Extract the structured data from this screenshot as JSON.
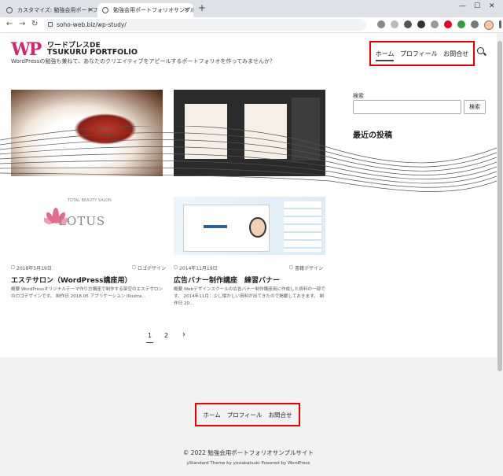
{
  "browser": {
    "tabs": [
      {
        "title": "カスタマイズ: 勉強会用ポートフォリオサ",
        "active": false
      },
      {
        "title": "勉強会用ポートフォリオサンプルサイト",
        "active": true
      }
    ],
    "new_tab": "+",
    "url": "soho-web.biz/wp-study/",
    "window_controls": {
      "minimize": "—",
      "maximize": "☐",
      "close": "✕"
    },
    "back": "←",
    "forward": "→",
    "reload": "↻"
  },
  "header": {
    "logo_mark": "WP",
    "logo_line1": "ワードプレスDE",
    "logo_line2": "TSUKURU PORTFOLIO",
    "tagline": "WordPressの勉強も兼ねて、あなたのクリエイティブをアピールするポートフォリオを作ってみませんか？",
    "nav": [
      {
        "label": "ホーム",
        "current": true
      },
      {
        "label": "プロフィール",
        "current": false
      },
      {
        "label": "お問合せ",
        "current": false
      }
    ],
    "highlight_color": "#e00000",
    "accent_color": "#d8256b"
  },
  "posts": [
    {
      "image_alt": "LOTUS",
      "image_small_text": "TOTAL BEAUTY SALON",
      "date": "2018年5月19日",
      "category": "ロゴデザイン",
      "title": "エステサロン（WordPress講座用）",
      "excerpt": "概要 WordPressオリジナルテーマ作り方講座で制作する架空のエステサロンのロゴデザインです。 制作日 2018.05 アプリケーション Illustra..."
    },
    {
      "date": "2014年11月19日",
      "category": "書籍デザイン",
      "title": "広告バナー制作講座　練習バナー",
      "excerpt": "概要 Webデザインスクールの広告バナー制作講座用に作成した資料の一部です。 2014年11月：少し懐かしい資料が出てきたので掲載しておきます。 制作日 20..."
    }
  ],
  "sidebar": {
    "search_label": "検索",
    "search_value": "",
    "search_button": "検索",
    "recent_heading": "最近の投稿"
  },
  "pagination": {
    "pages": [
      "1",
      "2"
    ],
    "current": "1",
    "next": "›"
  },
  "footer": {
    "nav": [
      "ホーム",
      "プロフィール",
      "お問合せ"
    ],
    "copyright": "© 2022 勉強会用ポートフォリオサンプルサイト",
    "credit": "yStandard Theme by yosiakatsuki Powered by WordPress"
  }
}
